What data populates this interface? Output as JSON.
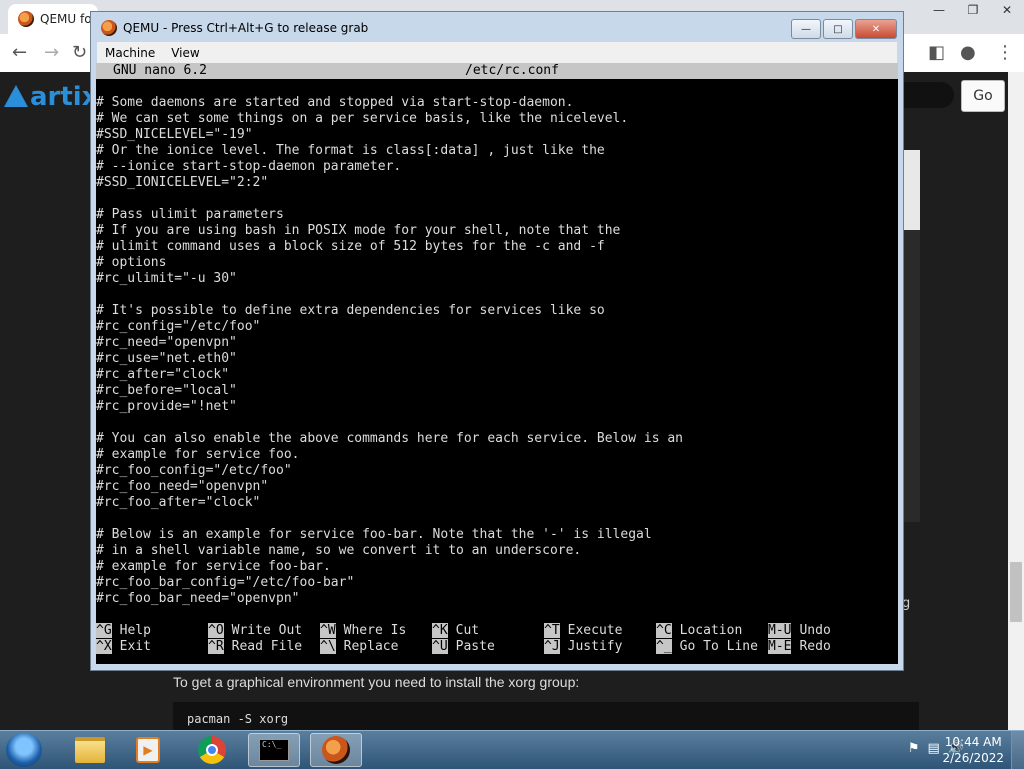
{
  "chrome": {
    "tab_title": "QEMU fo",
    "go_label": "Go",
    "logo_text": "artix",
    "page_fragment": "g",
    "doc_text": "To get a graphical environment you need to install the xorg group:",
    "doc_code": "pacman -S xorg"
  },
  "qemu": {
    "title": "QEMU - Press Ctrl+Alt+G to release grab",
    "menu": [
      "Machine",
      "View"
    ]
  },
  "nano": {
    "version": "GNU nano 6.2",
    "filename": "/etc/rc.conf",
    "lines": [
      "# Some daemons are started and stopped via start-stop-daemon.",
      "# We can set some things on a per service basis, like the nicelevel.",
      "#SSD_NICELEVEL=\"-19\"",
      "# Or the ionice level. The format is class[:data] , just like the",
      "# --ionice start-stop-daemon parameter.",
      "#SSD_IONICELEVEL=\"2:2\"",
      "",
      "# Pass ulimit parameters",
      "# If you are using bash in POSIX mode for your shell, note that the",
      "# ulimit command uses a block size of 512 bytes for the -c and -f",
      "# options",
      "#rc_ulimit=\"-u 30\"",
      "",
      "# It's possible to define extra dependencies for services like so",
      "#rc_config=\"/etc/foo\"",
      "#rc_need=\"openvpn\"",
      "#rc_use=\"net.eth0\"",
      "#rc_after=\"clock\"",
      "#rc_before=\"local\"",
      "#rc_provide=\"!net\"",
      "",
      "# You can also enable the above commands here for each service. Below is an",
      "# example for service foo.",
      "#rc_foo_config=\"/etc/foo\"",
      "#rc_foo_need=\"openvpn\"",
      "#rc_foo_after=\"clock\"",
      "",
      "# Below is an example for service foo-bar. Note that the '-' is illegal",
      "# in a shell variable name, so we convert it to an underscore.",
      "# example for service foo-bar.",
      "#rc_foo_bar_config=\"/etc/foo-bar\"",
      "#rc_foo_bar_need=\"openvpn\""
    ],
    "shortcuts": [
      {
        "key": "^G",
        "label": "Help"
      },
      {
        "key": "^O",
        "label": "Write Out"
      },
      {
        "key": "^W",
        "label": "Where Is"
      },
      {
        "key": "^K",
        "label": "Cut"
      },
      {
        "key": "^T",
        "label": "Execute"
      },
      {
        "key": "^C",
        "label": "Location"
      },
      {
        "key": "M-U",
        "label": "Undo"
      },
      {
        "key": "^X",
        "label": "Exit"
      },
      {
        "key": "^R",
        "label": "Read File"
      },
      {
        "key": "^\\",
        "label": "Replace"
      },
      {
        "key": "^U",
        "label": "Paste"
      },
      {
        "key": "^J",
        "label": "Justify"
      },
      {
        "key": "^_",
        "label": "Go To Line"
      },
      {
        "key": "M-E",
        "label": "Redo"
      }
    ]
  },
  "taskbar": {
    "time": "10:44 AM",
    "date": "2/26/2022",
    "cmd_icon_text": "C:\\_"
  },
  "icons": {
    "qemu": "qemu-icon",
    "chrome": "chrome-icon",
    "folder": "folder-icon",
    "media": "media-player-icon",
    "cmd": "command-prompt-icon"
  }
}
